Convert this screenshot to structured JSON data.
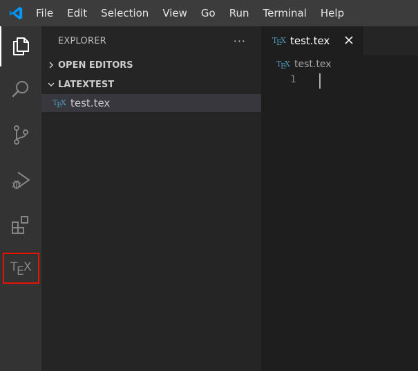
{
  "menu": {
    "items": [
      "File",
      "Edit",
      "Selection",
      "View",
      "Go",
      "Run",
      "Terminal",
      "Help"
    ]
  },
  "activity_bar": {
    "items": [
      "explorer-icon",
      "search-icon",
      "source-control-icon",
      "run-debug-icon",
      "extensions-icon",
      "tex-icon"
    ],
    "tex_logo": "TEX"
  },
  "sidebar": {
    "title": "EXPLORER",
    "more": "···",
    "sections": {
      "open_editors": "OPEN EDITORS",
      "workspace": "LATEXTEST"
    },
    "files": [
      {
        "label": "test.tex",
        "icon": "tex-file-icon"
      }
    ]
  },
  "editor": {
    "tab": {
      "label": "test.tex",
      "close": "✕"
    },
    "breadcrumb": "test.tex",
    "lines": [
      "1"
    ]
  },
  "colors": {
    "titlebar": "#3c3c3c",
    "activitybar": "#333333",
    "sidebar": "#252526",
    "editor": "#1e1e1e",
    "highlight_box": "#e51400",
    "tex_icon": "#519aba",
    "vscode_blue": "#0098ff"
  }
}
